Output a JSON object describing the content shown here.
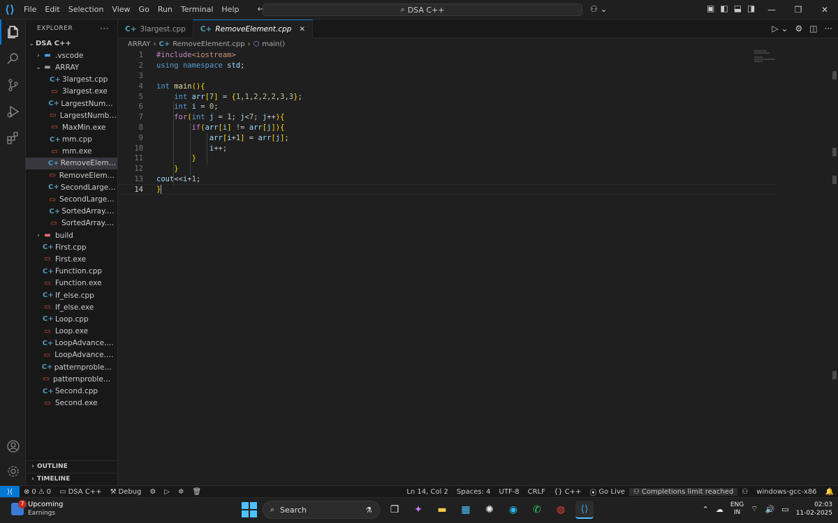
{
  "titlebar": {
    "menu": [
      "File",
      "Edit",
      "Selection",
      "View",
      "Go",
      "Run",
      "Terminal",
      "Help"
    ],
    "search_text": "DSA C++"
  },
  "explorer": {
    "header": "EXPLORER",
    "workspace": "DSA C++",
    "items": [
      {
        "label": ".vscode",
        "type": "folder-blue",
        "indent": 1,
        "chev": ">"
      },
      {
        "label": "ARRAY",
        "type": "folder",
        "indent": 1,
        "chev": "v"
      },
      {
        "label": "3largest.cpp",
        "type": "cpp",
        "indent": 2,
        "chev": ""
      },
      {
        "label": "3largest.exe",
        "type": "exe",
        "indent": 2,
        "chev": ""
      },
      {
        "label": "LargestNumber....",
        "type": "cpp",
        "indent": 2,
        "chev": ""
      },
      {
        "label": "LargestNumber....",
        "type": "exe",
        "indent": 2,
        "chev": ""
      },
      {
        "label": "MaxMin.exe",
        "type": "exe",
        "indent": 2,
        "chev": ""
      },
      {
        "label": "mm.cpp",
        "type": "cpp",
        "indent": 2,
        "chev": ""
      },
      {
        "label": "mm.exe",
        "type": "exe",
        "indent": 2,
        "chev": ""
      },
      {
        "label": "RemoveElement....",
        "type": "cpp",
        "indent": 2,
        "chev": "",
        "selected": true
      },
      {
        "label": "RemoveElement....",
        "type": "exe",
        "indent": 2,
        "chev": ""
      },
      {
        "label": "SecondLargest.c...",
        "type": "cpp",
        "indent": 2,
        "chev": ""
      },
      {
        "label": "SecondLargest.e...",
        "type": "exe",
        "indent": 2,
        "chev": ""
      },
      {
        "label": "SortedArray.cpp",
        "type": "cpp",
        "indent": 2,
        "chev": ""
      },
      {
        "label": "SortedArray.exe",
        "type": "exe",
        "indent": 2,
        "chev": ""
      },
      {
        "label": "build",
        "type": "folder-red",
        "indent": 1,
        "chev": ">"
      },
      {
        "label": "First.cpp",
        "type": "cpp",
        "indent": 1,
        "chev": ""
      },
      {
        "label": "First.exe",
        "type": "exe",
        "indent": 1,
        "chev": ""
      },
      {
        "label": "Function.cpp",
        "type": "cpp",
        "indent": 1,
        "chev": ""
      },
      {
        "label": "Function.exe",
        "type": "exe",
        "indent": 1,
        "chev": ""
      },
      {
        "label": "If_else.cpp",
        "type": "cpp",
        "indent": 1,
        "chev": ""
      },
      {
        "label": "If_else.exe",
        "type": "exe",
        "indent": 1,
        "chev": ""
      },
      {
        "label": "Loop.cpp",
        "type": "cpp",
        "indent": 1,
        "chev": ""
      },
      {
        "label": "Loop.exe",
        "type": "exe",
        "indent": 1,
        "chev": ""
      },
      {
        "label": "LoopAdvance.cpp",
        "type": "cpp",
        "indent": 1,
        "chev": ""
      },
      {
        "label": "LoopAdvance.exe",
        "type": "exe",
        "indent": 1,
        "chev": ""
      },
      {
        "label": "patternproblem.c...",
        "type": "cpp",
        "indent": 1,
        "chev": ""
      },
      {
        "label": "patternproblem.exe",
        "type": "exe",
        "indent": 1,
        "chev": ""
      },
      {
        "label": "Second.cpp",
        "type": "cpp",
        "indent": 1,
        "chev": ""
      },
      {
        "label": "Second.exe",
        "type": "exe",
        "indent": 1,
        "chev": ""
      }
    ],
    "outline_label": "OUTLINE",
    "timeline_label": "TIMELINE"
  },
  "tabs": [
    {
      "label": "3largest.cpp",
      "active": false
    },
    {
      "label": "RemoveElement.cpp",
      "active": true
    }
  ],
  "breadcrumb": {
    "folder": "ARRAY",
    "file": "RemoveElement.cpp",
    "symbol": "main()"
  },
  "editor": {
    "lines": [
      "#include<iostream>",
      "using namespace std;",
      "",
      "int main(){",
      "    int arr[7] = {1,1,2,2,2,3,3};",
      "    int i = 0;",
      "    for(int j = 1; j<7; j++){",
      "        if(arr[i] != arr[j]){",
      "            arr[i+1] = arr[j];",
      "            i++;",
      "        }",
      "    }",
      "cout<<i+1;",
      "}"
    ],
    "current_line": 14
  },
  "statusbar": {
    "errors": "0",
    "warnings": "0",
    "workspace": "DSA C++",
    "debug": "Debug",
    "position": "Ln 14, Col 2",
    "spaces": "Spaces: 4",
    "encoding": "UTF-8",
    "eol": "CRLF",
    "language": "C++",
    "golive": "Go Live",
    "completions": "Completions limit reached",
    "config": "windows-gcc-x86"
  },
  "taskbar": {
    "weather_badge": "7",
    "weather_title": "Upcoming",
    "weather_sub": "Earnings",
    "search_label": "Search",
    "lang_top": "ENG",
    "lang_bottom": "IN",
    "time": "02:03",
    "date": "11-02-2025"
  }
}
